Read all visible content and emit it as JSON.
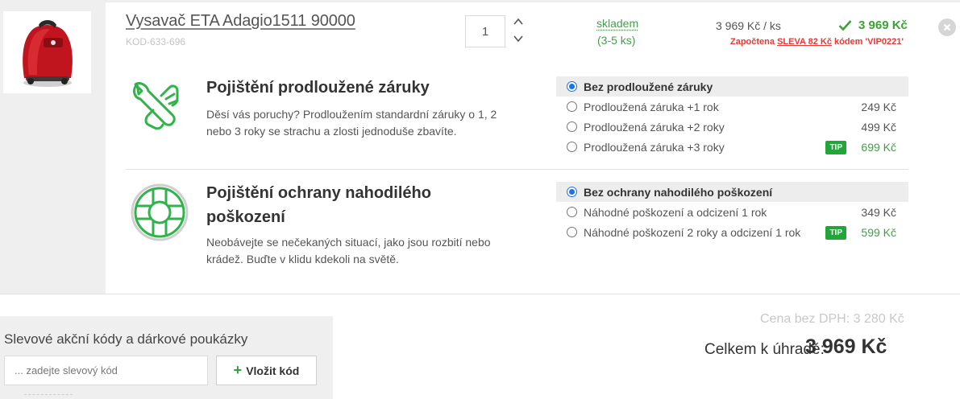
{
  "product": {
    "name": "Vysavač ETA Adagio1511 90000",
    "code": "KOD-633-696",
    "quantity": "1",
    "stock_status": "skladem",
    "stock_count": "(3-5 ks)",
    "unit_price": "3 969 Kč / ks",
    "line_total": "3 969 Kč",
    "discount_prefix": "Započtena",
    "discount_link": "SLEVA 82 Kč",
    "discount_suffix": "kódem 'VIP0221'",
    "image_icon": "vacuum-cleaner-image"
  },
  "warranty": {
    "title": "Pojištění prodloužené záruky",
    "description_line1": "Děsí vás poruchy? Prodloužením standardní záruky o 1, 2",
    "description_line2": "nebo 3 roky se strachu a zlosti jednoduše zbavíte.",
    "icon": "wrench-hand-icon",
    "options": [
      {
        "label": "Bez prodloužené záruky",
        "price": "",
        "selected": true,
        "tip": false
      },
      {
        "label": "Prodloužená záruka +1 rok",
        "price": "249 Kč",
        "selected": false,
        "tip": false
      },
      {
        "label": "Prodloužená záruka +2 roky",
        "price": "499 Kč",
        "selected": false,
        "tip": false
      },
      {
        "label": "Prodloužená záruka +3 roky",
        "price": "699 Kč",
        "selected": false,
        "tip": true
      }
    ]
  },
  "damage": {
    "title_line1": "Pojištění ochrany nahodilého",
    "title_line2": "poškození",
    "description_line1": "Neobávejte se nečekaných situací, jako jsou rozbití nebo",
    "description_line2": "krádež. Buďte v klidu kdekoli na světě.",
    "icon": "lifebuoy-icon",
    "options": [
      {
        "label": "Bez ochrany nahodilého poškození",
        "price": "",
        "selected": true,
        "tip": false
      },
      {
        "label": "Náhodné poškození a odcizení 1 rok",
        "price": "349 Kč",
        "selected": false,
        "tip": false
      },
      {
        "label": "Náhodné poškození 2 roky a odcizení 1 rok",
        "price": "599 Kč",
        "selected": false,
        "tip": true
      }
    ]
  },
  "tip_label": "TIP",
  "promo": {
    "label": "Slevové akční kódy a dárkové poukázky",
    "placeholder": "... zadejte slevový kód",
    "button_label": "Vložit kód"
  },
  "summary": {
    "price_no_vat": "Cena bez DPH: 3 280 Kč",
    "total_label": "Celkem k úhradě:",
    "total_value": "3 969 Kč"
  },
  "colors": {
    "accent_green": "#3aa335",
    "discount_red": "#e53935",
    "radio_blue": "#1a73e8"
  }
}
